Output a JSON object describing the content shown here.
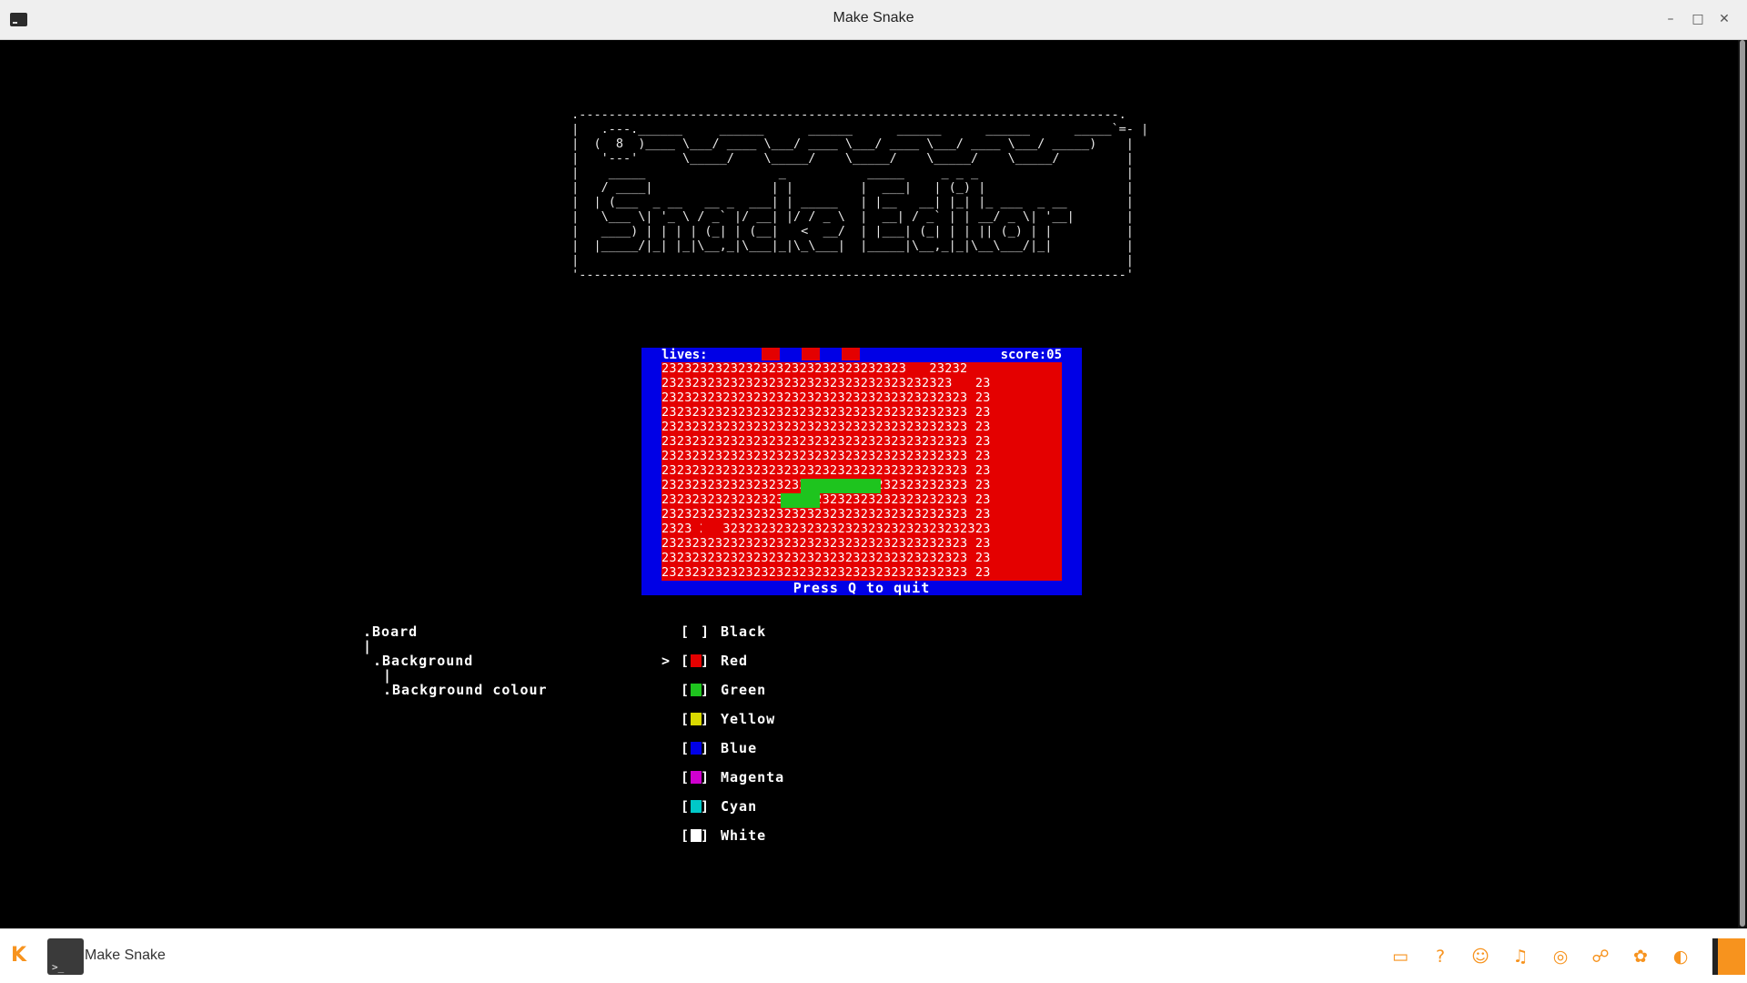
{
  "window": {
    "title": "Make Snake"
  },
  "banner": {
    "lines": [
      " .-------------------------------------------------------------------------.",
      " |   .---.______     ______      ______      ______      ______      _____`=- |",
      " |  (  8  )____ \\___/ ____ \\___/ ____ \\___/ ____ \\___/ ____ \\___/ _____)    |",
      " |   '---'      \\_____/    \\_____/    \\_____/    \\_____/    \\_____/         |",
      " |    _____                  _           _____     _ _ _                    |",
      " |   / ____|                | |         |  ___|   | (_) |                   |",
      " |  | (___  _ __   __ _  ___| | _____   | |__   __| |_| |_ ___  _ __        |",
      " |   \\___ \\| '_ \\ / _` |/ __| |/ / _ \\  |  __| / _` | | __/ _ \\| '__|       |",
      " |   ____) | | | | (_| | (__|   <  __/  | |___| (_| | | || (_) | |          |",
      " |  |_____/|_| |_|\\__,_|\\___|_|\\_\\___|  |_____|\\__,_|_|\\__\\___/|_|          |",
      " |                                                                          |",
      " '--------------------------------------------------------------------------'"
    ]
  },
  "game": {
    "lives_label": "lives:",
    "score_label": "score:05",
    "rows": [
      "23232323232323232323232323232323   23232 3",
      "23232323232323232323232323232323232323   23",
      "2323232323232323232323232323232323232323 23",
      "2323232323232323232323232323232323232323 23",
      "2323232323232323232323232323232323232323 23",
      "2323232323232323232323232323232323232323 23",
      "2323232323232323232323232323232323232323 23",
      "2323232323232323232323232323232323232323 23",
      "2323232323232323232323232323232323232323 23",
      "2323232323232323232323232323232323232323 23",
      "2323232323232323232323232323232323232323 23",
      "2323 23232323232323232323232323232323232323",
      "2323232323232323232323232323232323232323 23",
      "2323232323232323232323232323232323232323 23",
      "2323232323232323232323232323232323232323 23"
    ],
    "quit_hint": "Press Q to quit"
  },
  "menu_tree": {
    "board": ".Board",
    "pipe1": "|",
    "background": ".Background",
    "pipe2": "|",
    "background_colour": ".Background colour"
  },
  "colour_options": {
    "pointer": ">",
    "items": [
      {
        "label": "Black",
        "color": "#000000",
        "selected": false
      },
      {
        "label": "Red",
        "color": "#e40000",
        "selected": true
      },
      {
        "label": "Green",
        "color": "#1ec41e",
        "selected": false
      },
      {
        "label": "Yellow",
        "color": "#d8d800",
        "selected": false
      },
      {
        "label": "Blue",
        "color": "#0000e6",
        "selected": false
      },
      {
        "label": "Magenta",
        "color": "#d000d0",
        "selected": false
      },
      {
        "label": "Cyan",
        "color": "#00c8c8",
        "selected": false
      },
      {
        "label": "White",
        "color": "#ffffff",
        "selected": false
      }
    ]
  },
  "taskbar": {
    "task_label": "Make Snake",
    "tray_icons": [
      "window-list-icon",
      "help-icon",
      "users-icon",
      "notifications-icon",
      "network-icon",
      "kdeconnect-icon",
      "updates-icon",
      "power-icon"
    ]
  }
}
